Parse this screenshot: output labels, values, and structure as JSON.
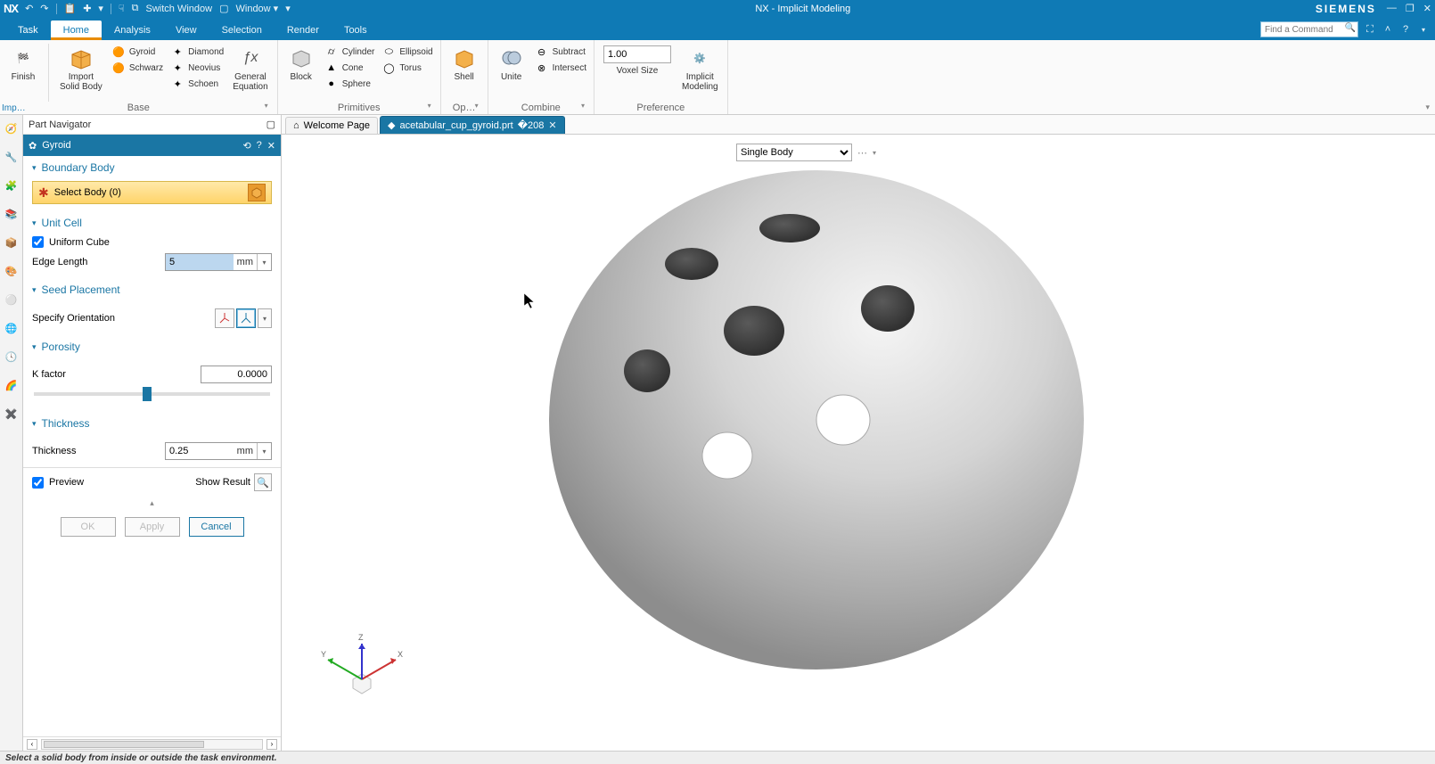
{
  "title": "NX - Implicit Modeling",
  "brand": "SIEMENS",
  "qat": {
    "switch_window": "Switch Window",
    "window": "Window"
  },
  "menus": {
    "task": "Task",
    "home": "Home",
    "analysis": "Analysis",
    "view": "View",
    "selection": "Selection",
    "render": "Render",
    "tools": "Tools"
  },
  "find_cmd_placeholder": "Find a Command",
  "ribbon": {
    "imp_label": "Imp…",
    "groups": {
      "base": {
        "label": "Base",
        "finish": "Finish",
        "import": "Import\nSolid Body",
        "gyroid": "Gyroid",
        "diamond": "Diamond",
        "neovius": "Neovius",
        "schwarz": "Schwarz",
        "schoen": "Schoen",
        "general_eq": "General\nEquation"
      },
      "primitives": {
        "label": "Primitives",
        "block": "Block",
        "cylinder": "Cylinder",
        "cone": "Cone",
        "sphere": "Sphere",
        "ellipsoid": "Ellipsoid",
        "torus": "Torus"
      },
      "op": {
        "label": "Op…",
        "shell": "Shell"
      },
      "combine": {
        "label": "Combine",
        "unite": "Unite",
        "subtract": "Subtract",
        "intersect": "Intersect"
      },
      "preference": {
        "label": "Preference",
        "voxel_value": "1.00",
        "voxel_label": "Voxel Size",
        "implicit": "Implicit\nModeling"
      }
    }
  },
  "part_navigator": "Part Navigator",
  "dialog": {
    "title": "Gyroid",
    "boundary_body": "Boundary Body",
    "select_body": "Select Body (0)",
    "unit_cell": "Unit Cell",
    "uniform_cube": "Uniform Cube",
    "edge_length_label": "Edge Length",
    "edge_length_value": "5",
    "unit_mm": "mm",
    "seed_placement": "Seed Placement",
    "specify_orientation": "Specify Orientation",
    "porosity": "Porosity",
    "k_factor": "K factor",
    "k_factor_value": "0.0000",
    "slider_pos_percent": 46,
    "thickness": "Thickness",
    "thickness_label": "Thickness",
    "thickness_value": "0.25",
    "preview": "Preview",
    "show_result": "Show Result",
    "ok": "OK",
    "apply": "Apply",
    "cancel": "Cancel"
  },
  "tabs": {
    "welcome": "Welcome Page",
    "part": "acetabular_cup_gyroid.prt"
  },
  "vp_mode": "Single Body",
  "status": "Select a solid body from inside or outside the task environment.",
  "triad": {
    "x": "X",
    "y": "Y",
    "z": "Z"
  }
}
